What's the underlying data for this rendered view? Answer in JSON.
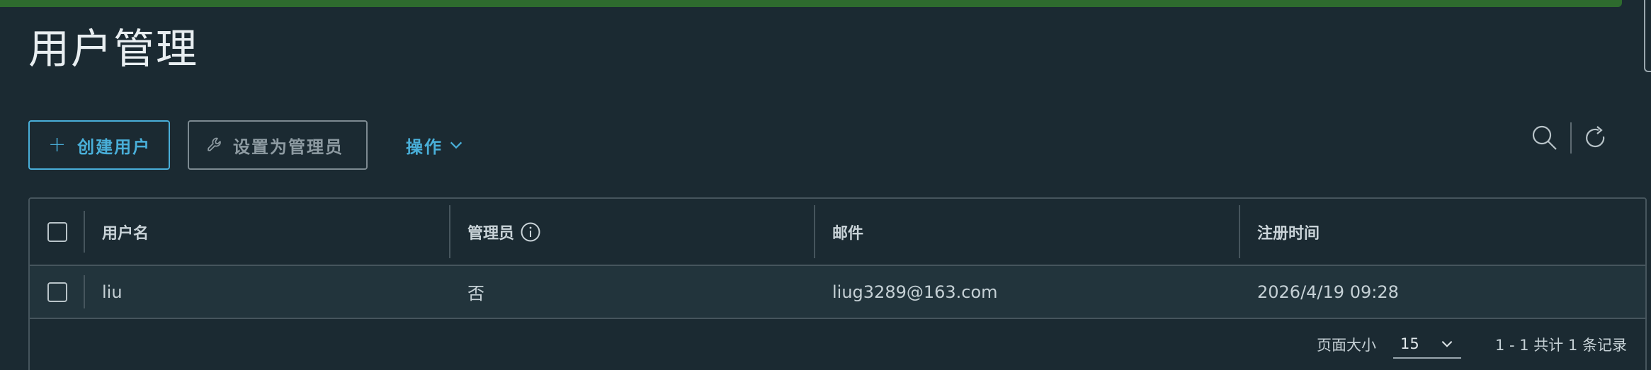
{
  "page": {
    "title": "用户管理"
  },
  "toolbar": {
    "create_label": "创建用户",
    "set_admin_label": "设置为管理员",
    "actions_label": "操作"
  },
  "table": {
    "columns": [
      "用户名",
      "管理员",
      "邮件",
      "注册时间"
    ],
    "rows": [
      {
        "username": "liu",
        "admin": "否",
        "email": "liug3289@163.com",
        "registered": "2026/4/19 09:28"
      }
    ]
  },
  "footer": {
    "page_size_label": "页面大小",
    "page_size_value": "15",
    "summary": "1 - 1 共计 1 条记录"
  },
  "icons": {
    "create": "plus-icon",
    "set_admin": "wrench-icon",
    "actions": "chevron-down-icon",
    "search": "search-icon",
    "refresh": "refresh-icon",
    "admin_info": "info-icon"
  },
  "colors": {
    "background": "#1b2a32",
    "accent": "#49afd9",
    "top_bar": "#2e6b2e"
  }
}
